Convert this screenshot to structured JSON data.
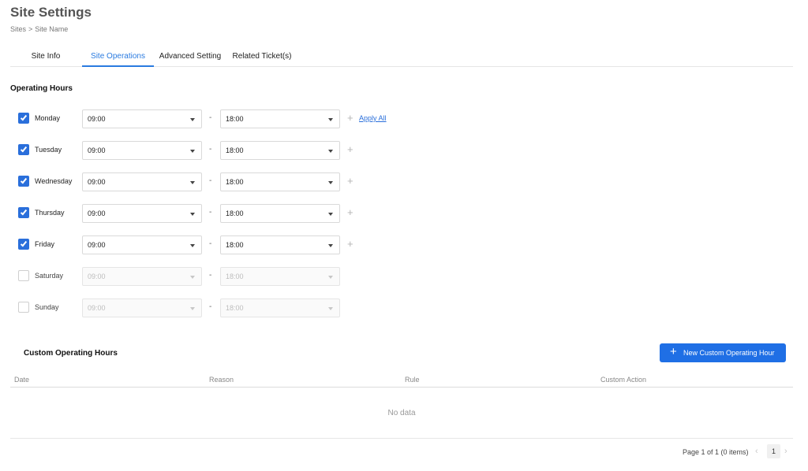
{
  "header": {
    "title": "Site Settings",
    "breadcrumb": [
      "Sites",
      ">",
      "Site Name"
    ]
  },
  "tabs": [
    {
      "label": "Site Info",
      "active": false
    },
    {
      "label": "Site Operations",
      "active": true
    },
    {
      "label": "Advanced Setting",
      "active": false
    },
    {
      "label": "Related Ticket(s)",
      "active": false
    }
  ],
  "operating_hours": {
    "title": "Operating Hours",
    "separator": "-",
    "apply_all_label": "Apply All",
    "days": [
      {
        "day": "Monday",
        "checked": true,
        "start": "09:00",
        "end": "18:00"
      },
      {
        "day": "Tuesday",
        "checked": true,
        "start": "09:00",
        "end": "18:00"
      },
      {
        "day": "Wednesday",
        "checked": true,
        "start": "09:00",
        "end": "18:00"
      },
      {
        "day": "Thursday",
        "checked": true,
        "start": "09:00",
        "end": "18:00"
      },
      {
        "day": "Friday",
        "checked": true,
        "start": "09:00",
        "end": "18:00"
      },
      {
        "day": "Saturday",
        "checked": false,
        "start": "09:00",
        "end": "18:00"
      },
      {
        "day": "Sunday",
        "checked": false,
        "start": "09:00",
        "end": "18:00"
      }
    ]
  },
  "custom_hours": {
    "title": "Custom Operating Hours",
    "new_button_label": "New Custom Operating Hour",
    "columns": [
      "Date",
      "Reason",
      "Rule",
      "Custom Action"
    ],
    "empty_text": "No data"
  },
  "pagination": {
    "info": "Page 1 of 1 (0 items)",
    "current_page": "1"
  },
  "colors": {
    "accent": "#2a6fdb",
    "button": "#1f6fe5"
  },
  "icons": {
    "checkbox": "check-icon",
    "dropdown": "caret-down-icon",
    "add": "plus-icon",
    "prev": "chevron-left-icon",
    "next": "chevron-right-icon"
  }
}
